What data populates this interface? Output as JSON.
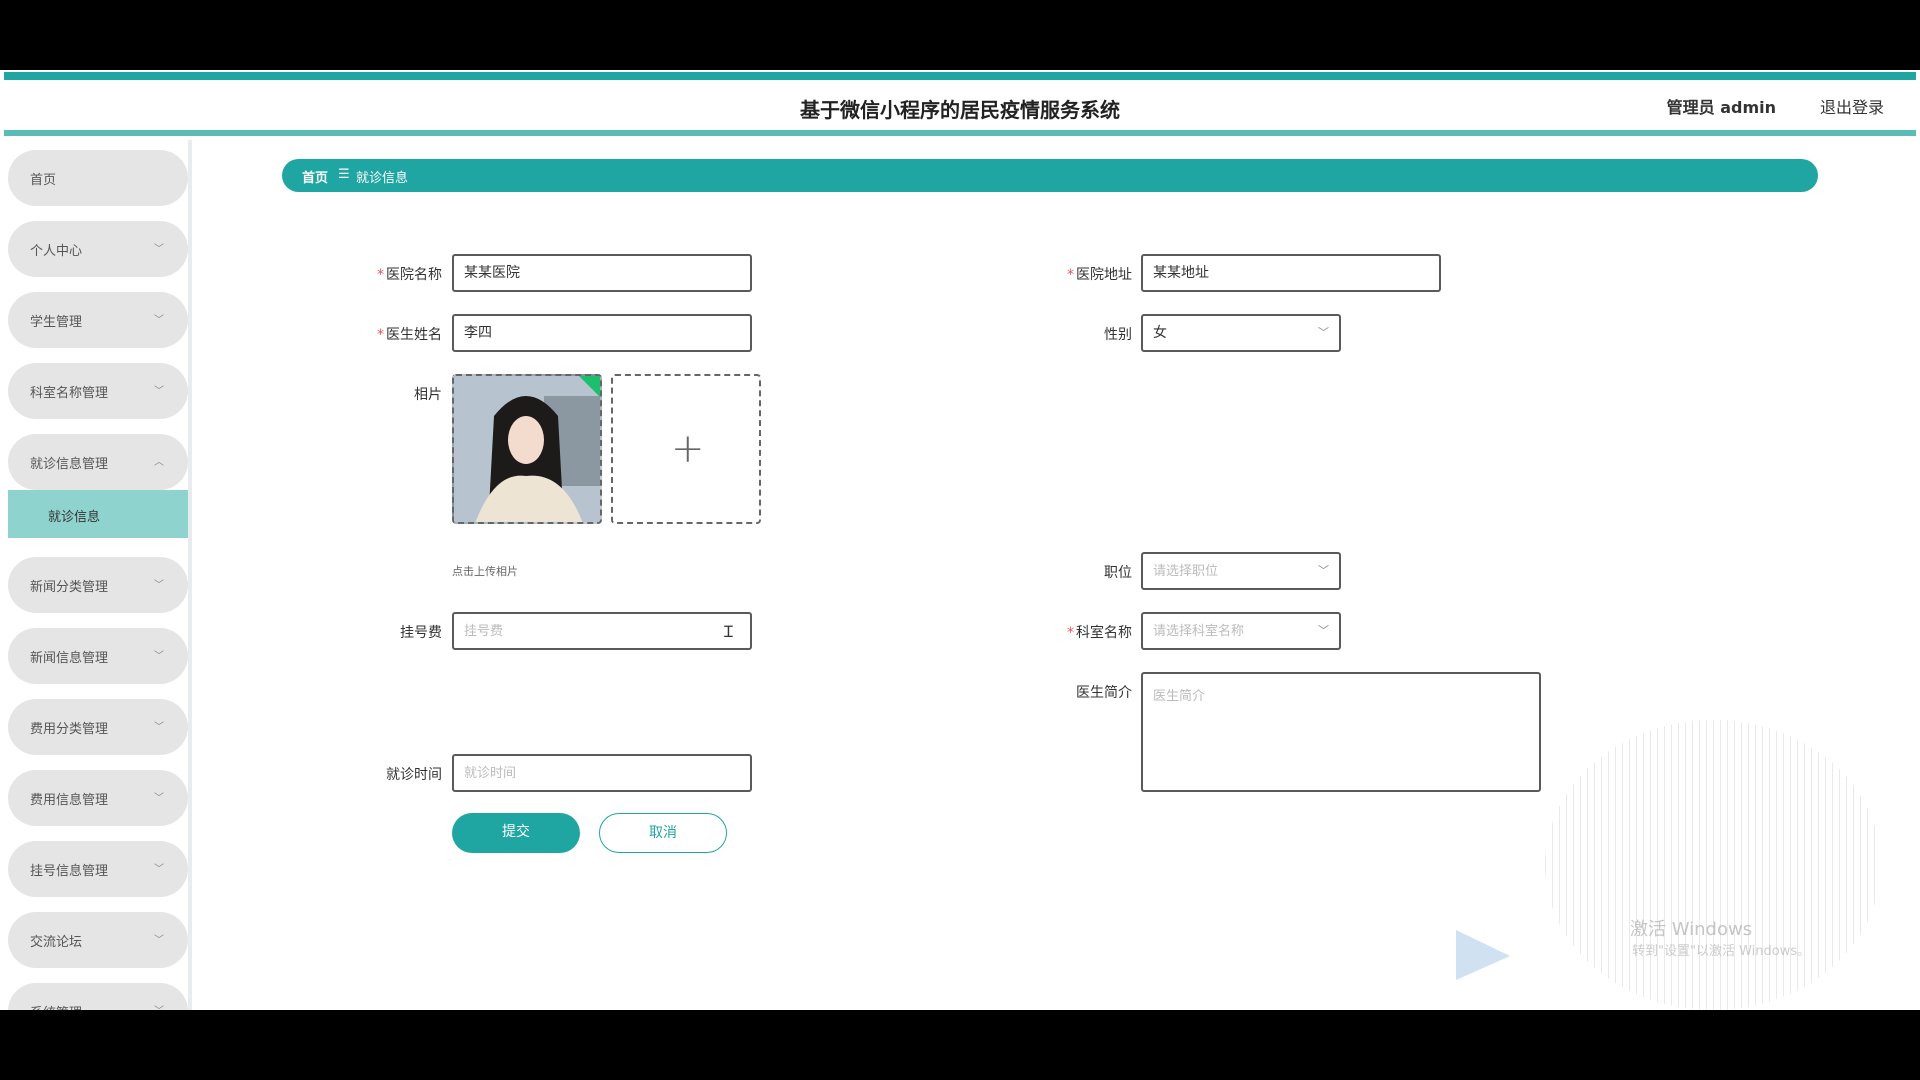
{
  "header": {
    "title": "基于微信小程序的居民疫情服务系统",
    "user": "管理员 admin",
    "logout": "退出登录",
    "accent_color": "#1fa5a2"
  },
  "sidebar": {
    "items": [
      {
        "label": "首页",
        "expandable": false
      },
      {
        "label": "个人中心",
        "expandable": true
      },
      {
        "label": "学生管理",
        "expandable": true
      },
      {
        "label": "科室名称管理",
        "expandable": true
      },
      {
        "label": "就诊信息管理",
        "expandable": true,
        "expanded": true
      },
      {
        "label": "就诊信息",
        "sub": true,
        "active": true
      },
      {
        "label": "新闻分类管理",
        "expandable": true
      },
      {
        "label": "新闻信息管理",
        "expandable": true
      },
      {
        "label": "费用分类管理",
        "expandable": true
      },
      {
        "label": "费用信息管理",
        "expandable": true
      },
      {
        "label": "挂号信息管理",
        "expandable": true
      },
      {
        "label": "交流论坛",
        "expandable": true
      },
      {
        "label": "系统管理",
        "expandable": true
      }
    ],
    "chevron_down": "﹀",
    "chevron_up": "︿"
  },
  "breadcrumb": {
    "home": "首页",
    "separator": "☰",
    "current": "就诊信息"
  },
  "form": {
    "hospital_name": {
      "label": "医院名称",
      "value": "某某医院",
      "required": true
    },
    "hospital_address": {
      "label": "医院地址",
      "value": "某某地址",
      "required": true
    },
    "doctor_name": {
      "label": "医生姓名",
      "value": "李四",
      "required": true
    },
    "gender": {
      "label": "性别",
      "value": "女"
    },
    "photo": {
      "label": "相片",
      "hint": "点击上传相片",
      "add_icon": "+"
    },
    "position": {
      "label": "职位",
      "placeholder": "请选择职位"
    },
    "fee": {
      "label": "挂号费",
      "placeholder": "挂号费"
    },
    "department": {
      "label": "科室名称",
      "placeholder": "请选择科室名称",
      "required": true
    },
    "intro": {
      "label": "医生简介",
      "placeholder": "医生简介"
    },
    "visit_time": {
      "label": "就诊时间",
      "placeholder": "就诊时间"
    },
    "required_mark": "*",
    "select_arrow": "﹀"
  },
  "buttons": {
    "submit": "提交",
    "cancel": "取消"
  },
  "watermark": {
    "line1": "激活 Windows",
    "line2": "转到\"设置\"以激活 Windows。"
  }
}
